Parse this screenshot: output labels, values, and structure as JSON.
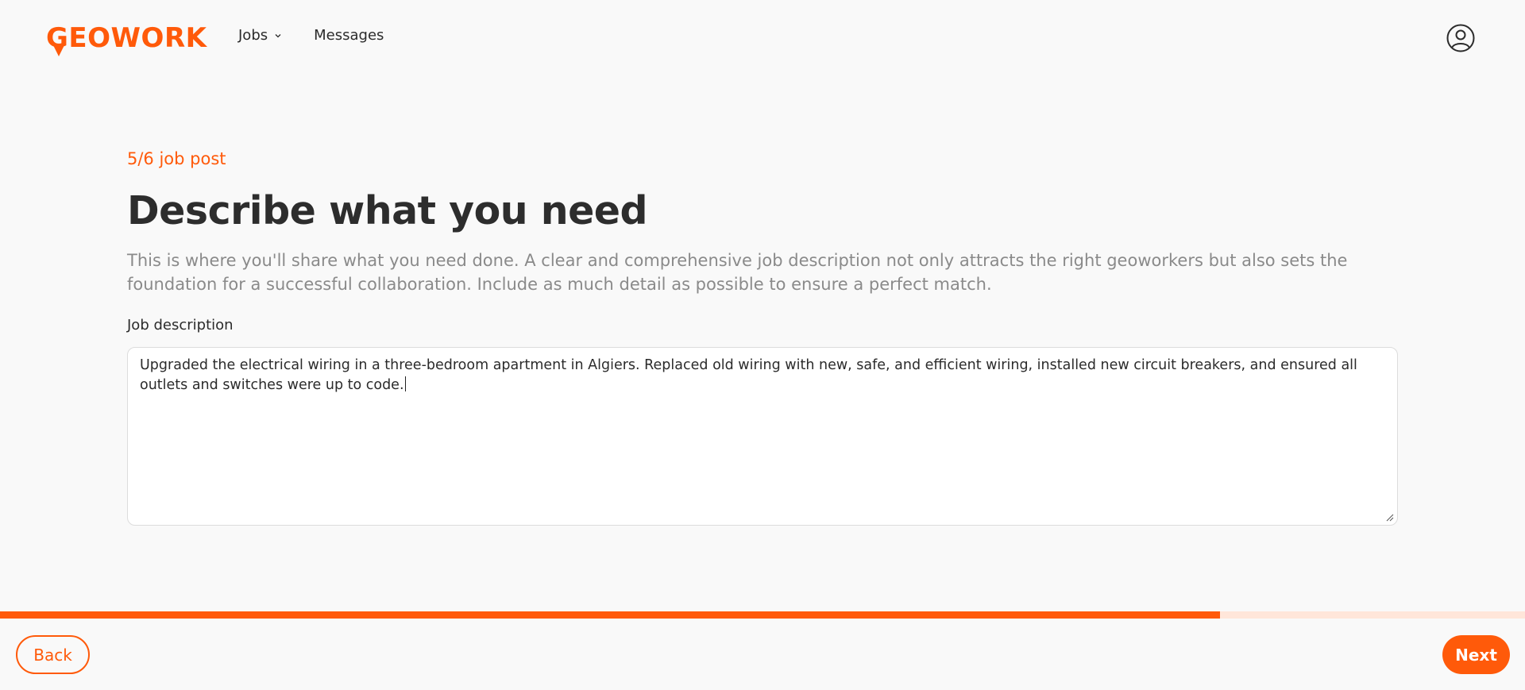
{
  "header": {
    "logo_text": "GEOWORK",
    "nav": [
      {
        "label": "Jobs",
        "has_dropdown": true,
        "icon": "chevron-down-icon"
      },
      {
        "label": "Messages",
        "has_dropdown": false
      }
    ],
    "profile_icon": "user-circle-icon"
  },
  "main": {
    "step_label": "5/6 job post",
    "title": "Describe what you need",
    "description": "This is where you'll share what you need done. A clear and comprehensive job description not only attracts the right geoworkers but also sets the foundation for a successful collaboration. Include as much detail as possible to ensure a perfect match.",
    "field_label": "Job description",
    "job_description_value": "Upgraded the electrical wiring in a three-bedroom apartment in Algiers. Replaced old wiring with new, safe, and efficient wiring, installed new circuit breakers, and ensured all outlets and switches were up to code."
  },
  "progress": {
    "fraction": 0.8
  },
  "footer": {
    "back_label": "Back",
    "next_label": "Next"
  },
  "colors": {
    "accent": "#ff5a0a",
    "progress_track": "#ffe6da",
    "background": "#f9f9f9",
    "muted_text": "#8a8a8a"
  }
}
